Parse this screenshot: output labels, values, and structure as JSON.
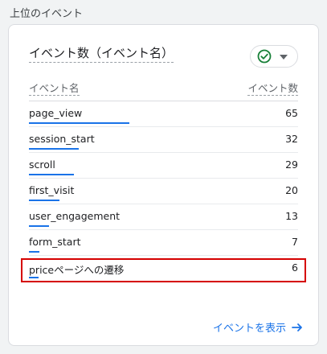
{
  "section": {
    "title": "上位のイベント"
  },
  "card": {
    "title": "イベント数（イベント名）",
    "status_icon": "check-circle-icon",
    "dropdown_icon": "caret-down-icon",
    "columns": {
      "name": "イベント名",
      "count": "イベント数"
    },
    "rows": [
      {
        "name": "page_view",
        "count": "65",
        "value": 65
      },
      {
        "name": "session_start",
        "count": "32",
        "value": 32
      },
      {
        "name": "scroll",
        "count": "29",
        "value": 29
      },
      {
        "name": "first_visit",
        "count": "20",
        "value": 20
      },
      {
        "name": "user_engagement",
        "count": "13",
        "value": 13
      },
      {
        "name": "form_start",
        "count": "7",
        "value": 7
      },
      {
        "name": "priceページへの遷移",
        "count": "6",
        "value": 6
      }
    ],
    "link": {
      "label": "イベントを表示",
      "icon": "arrow-right-icon"
    }
  },
  "colors": {
    "accent": "#1a73e8",
    "success": "#188038",
    "highlight": "#d50000"
  }
}
